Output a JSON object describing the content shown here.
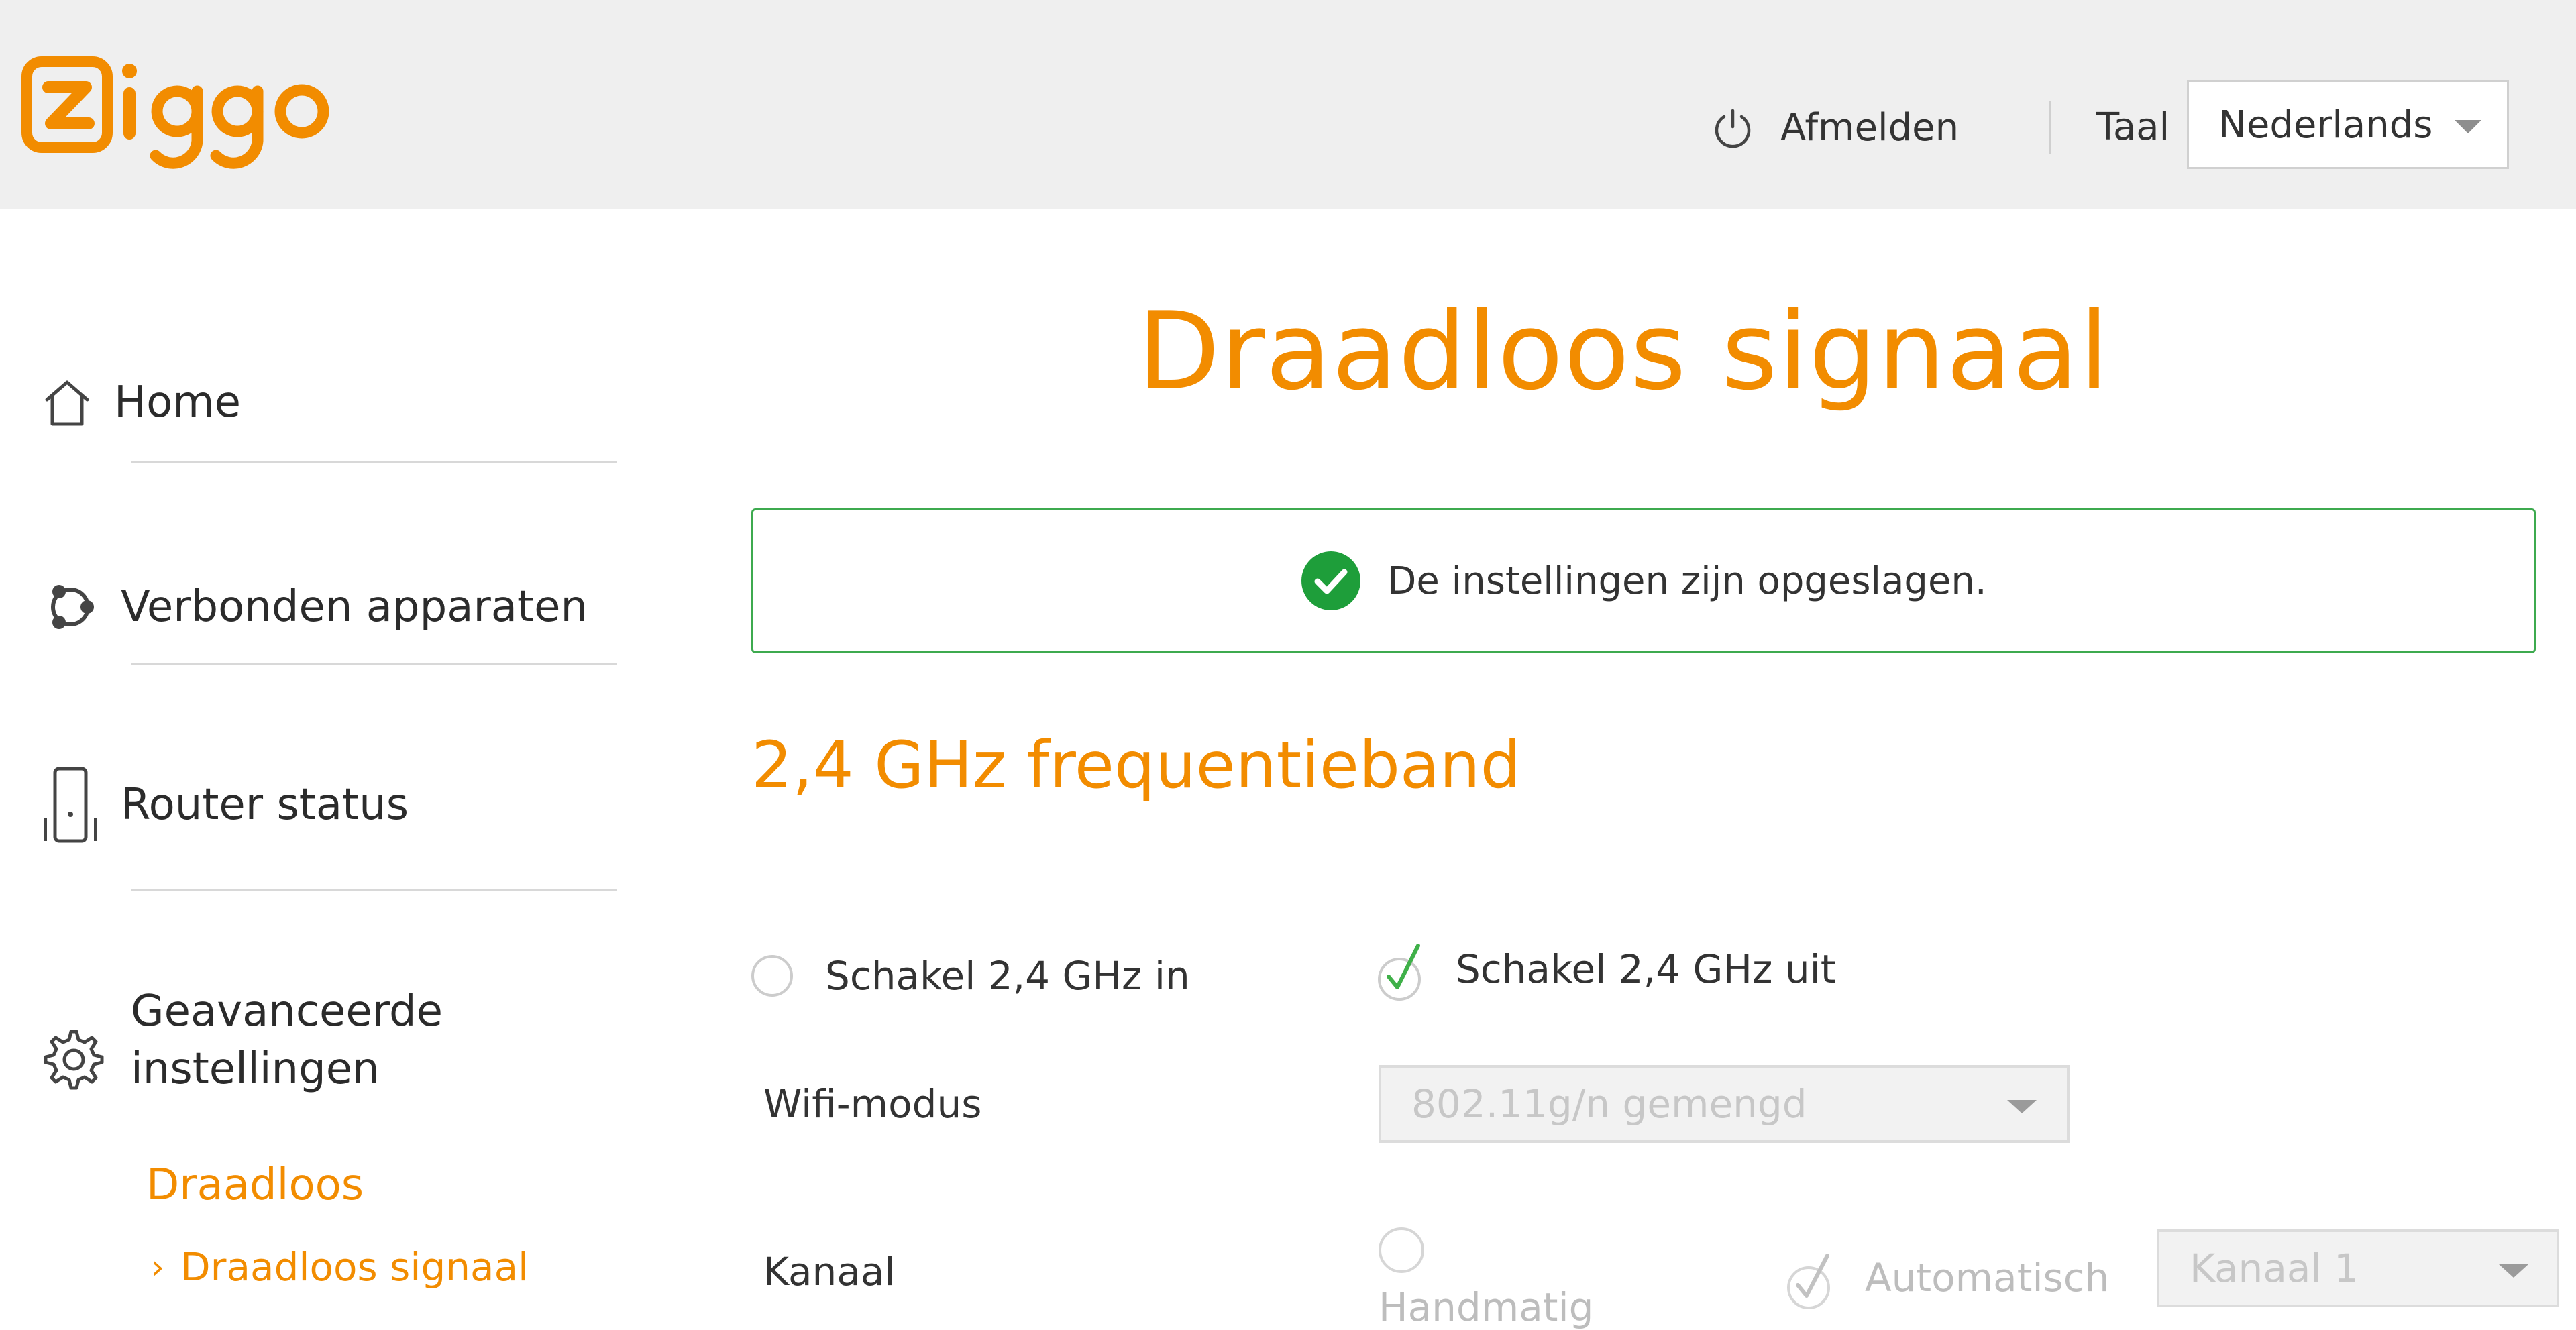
{
  "brand": {
    "logo_text": "ziggo",
    "accent_color": "#f28c00",
    "success_color": "#1e9e3a"
  },
  "header": {
    "logout_label": "Afmelden",
    "logout_icon": "power-icon",
    "language_label": "Taal",
    "language_selected": "Nederlands"
  },
  "sidebar": {
    "items": [
      {
        "label": "Home",
        "icon": "home-icon"
      },
      {
        "label": "Verbonden apparaten",
        "icon": "devices-icon"
      },
      {
        "label": "Router status",
        "icon": "router-icon"
      },
      {
        "label": "Geavanceerde instellingen",
        "icon": "gear-icon"
      }
    ],
    "submenu": {
      "group_label": "Draadloos",
      "active_item": "Draadloos signaal",
      "chevron": "›"
    }
  },
  "main": {
    "title": "Draadloos signaal",
    "notice": {
      "message": "De instellingen zijn opgeslagen.",
      "icon": "check-circle-icon"
    },
    "section_title": "2,4 GHz frequentieband",
    "band_toggle": {
      "on_label": "Schakel 2,4 GHz in",
      "off_label": "Schakel 2,4 GHz uit",
      "selected": "off"
    },
    "wifi_mode": {
      "label": "Wifi-modus",
      "value": "802.11g/n gemengd",
      "disabled": true
    },
    "channel": {
      "label": "Kanaal",
      "manual_label": "Handmatig",
      "auto_label": "Automatisch",
      "selected": "auto",
      "value": "Kanaal 1",
      "disabled": true
    }
  }
}
